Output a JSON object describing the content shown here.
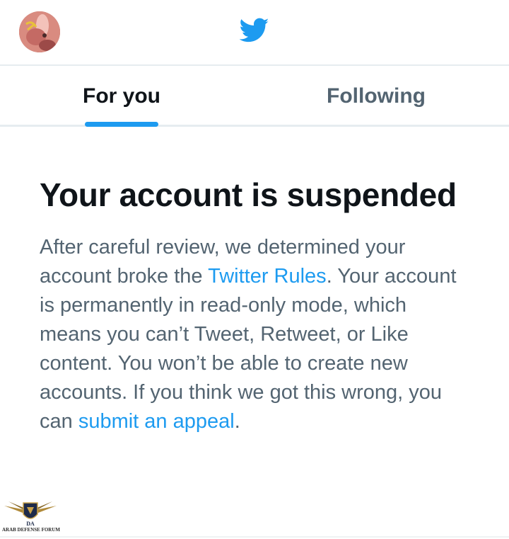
{
  "header": {
    "avatar_icon": "user-avatar",
    "logo_icon": "twitter-bird-icon",
    "brand_color": "#1d9bf0"
  },
  "tabs": [
    {
      "label": "For you",
      "selected": true
    },
    {
      "label": "Following",
      "selected": false
    }
  ],
  "notice": {
    "title": "Your account is suspended",
    "body_part1": "After careful review, we determined your account broke the ",
    "rules_link": "Twitter Rules",
    "body_part2": ". Your account is permanently in read-only mode, which means you can’t Tweet, Retweet, or Like content. You won’t be able to create new accounts. If you think we got this wrong, you can ",
    "appeal_link": "submit an appeal",
    "body_part3": "."
  },
  "watermark": {
    "text": "ARAB DEFENSE FORUM"
  }
}
